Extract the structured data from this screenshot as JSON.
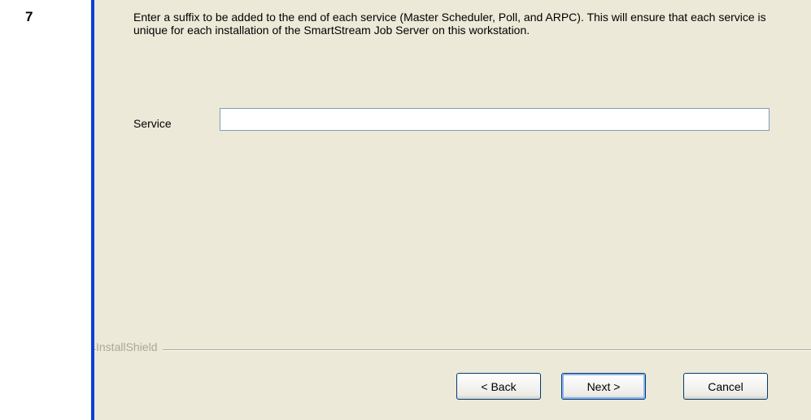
{
  "step": {
    "number": "7"
  },
  "dialog": {
    "description": "Enter a suffix to be added to the end of each service (Master Scheduler, Poll, and ARPC). This will ensure that each service is unique for each installation of the SmartStream Job Server on this workstation.",
    "service_label": "Service",
    "service_value": "",
    "footer_brand": "InstallShield",
    "buttons": {
      "back": "< Back",
      "next": "Next >",
      "cancel": "Cancel"
    }
  }
}
